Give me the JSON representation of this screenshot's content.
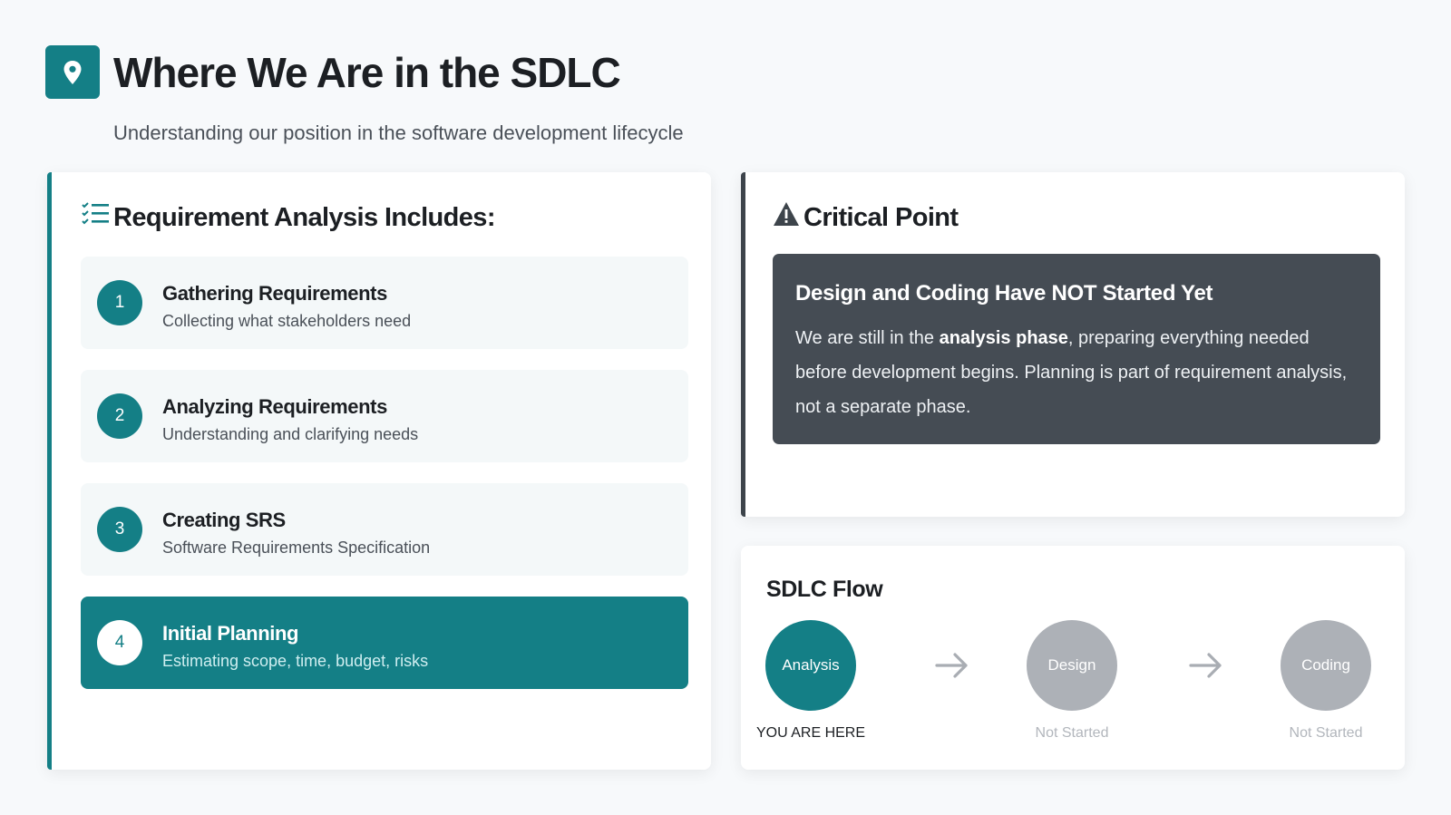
{
  "header": {
    "icon": "map-pin-icon",
    "title": "Where We Are in the SDLC",
    "subtitle": "Understanding our position in the software development lifecycle"
  },
  "requirements": {
    "icon": "checklist-icon",
    "heading": "Requirement Analysis Includes:",
    "items": [
      {
        "number": "1",
        "title": "Gathering Requirements",
        "description": "Collecting what stakeholders need",
        "active": false
      },
      {
        "number": "2",
        "title": "Analyzing Requirements",
        "description": "Understanding and clarifying needs",
        "active": false
      },
      {
        "number": "3",
        "title": "Creating SRS",
        "description": "Software Requirements Specification",
        "active": false
      },
      {
        "number": "4",
        "title": "Initial Planning",
        "description": "Estimating scope, time, budget, risks",
        "active": true
      }
    ]
  },
  "critical": {
    "icon": "warning-icon",
    "heading": "Critical Point",
    "box_title": "Design and Coding Have NOT Started Yet",
    "body_before": "We are still in the ",
    "body_bold": "analysis phase",
    "body_after": ", preparing everything needed before development begins. Planning is part of requirement analysis, not a separate phase."
  },
  "flow": {
    "heading": "SDLC Flow",
    "steps": [
      {
        "label": "Analysis",
        "status": "YOU ARE HERE",
        "current": true
      },
      {
        "label": "Design",
        "status": "Not Started",
        "current": false
      },
      {
        "label": "Coding",
        "status": "Not Started",
        "current": false
      }
    ]
  },
  "colors": {
    "accent": "#147f86",
    "dark_panel": "#454c54",
    "inactive": "#adb1b7"
  }
}
